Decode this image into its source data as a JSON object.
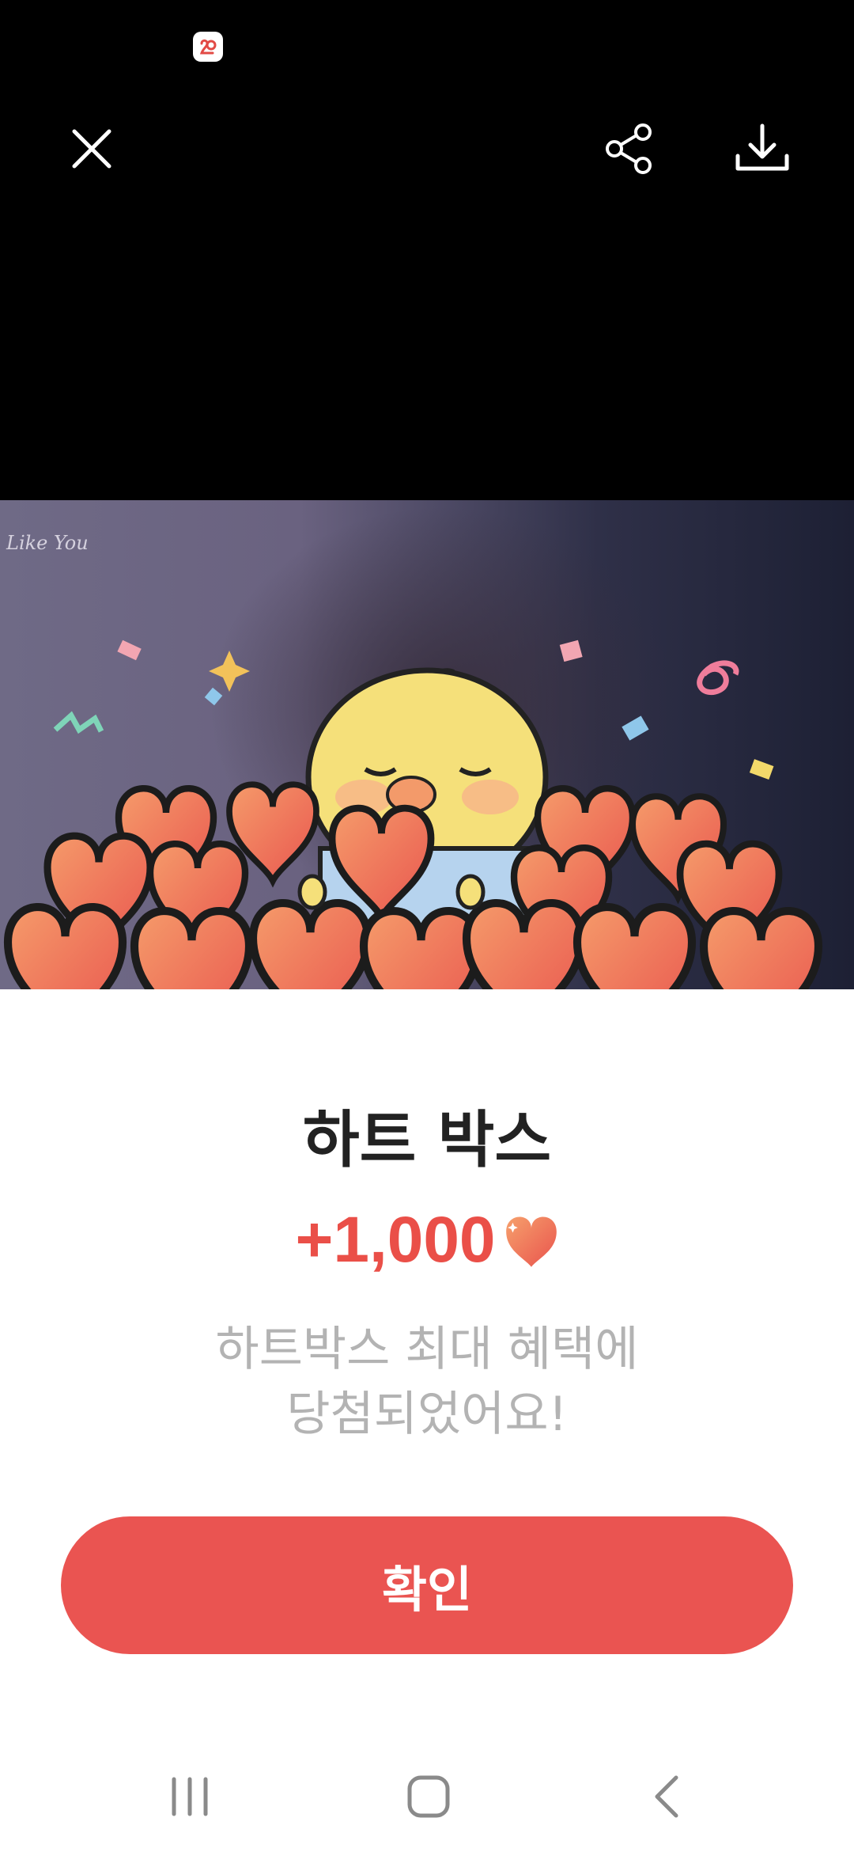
{
  "top_bar": {
    "status_icon": "notification-icon",
    "close_icon": "close-icon",
    "share_icon": "share-icon",
    "download_icon": "download-icon"
  },
  "media": {
    "watermark_text": "Like You"
  },
  "dialog": {
    "title": "하트 박스",
    "reward_amount": "+1,000",
    "message_line1": "하트박스 최대 혜택에",
    "message_line2": "당첨되었어요!",
    "confirm_label": "확인"
  },
  "nav_bar": {
    "recents_icon": "recents-icon",
    "home_icon": "home-icon",
    "back_icon": "back-icon"
  },
  "colors": {
    "accent": "#ea5451",
    "title": "#222222",
    "message": "#b3b3b3",
    "topbar_bg": "#000000"
  }
}
